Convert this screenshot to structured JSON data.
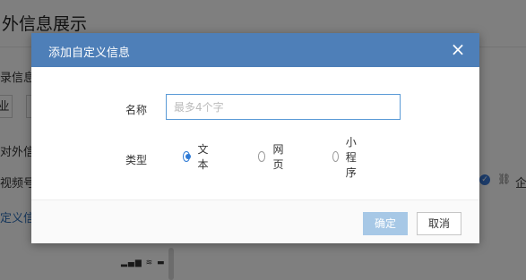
{
  "background": {
    "title": "外信息展示",
    "row1_text": "录信息",
    "btn1_label": "业",
    "row2_text": "对外信",
    "row3_text": "视频号",
    "row4_text": "定义信",
    "right_text": "企",
    "status_icons": "▂▄▆ ≋ ▬"
  },
  "modal": {
    "title": "添加自定义信息",
    "close_icon": "×",
    "name_label": "名称",
    "name_value": "",
    "name_placeholder": "最多4个字",
    "type_label": "类型",
    "type_options": [
      {
        "label": "文本",
        "checked": true
      },
      {
        "label": "网页",
        "checked": false
      },
      {
        "label": "小程序",
        "checked": false
      }
    ],
    "confirm_label": "确定",
    "cancel_label": "取消"
  },
  "colors": {
    "header": "#4e7fb8",
    "confirm_disabled": "#a7c8e6",
    "radio_accent": "#2f7bd6"
  }
}
